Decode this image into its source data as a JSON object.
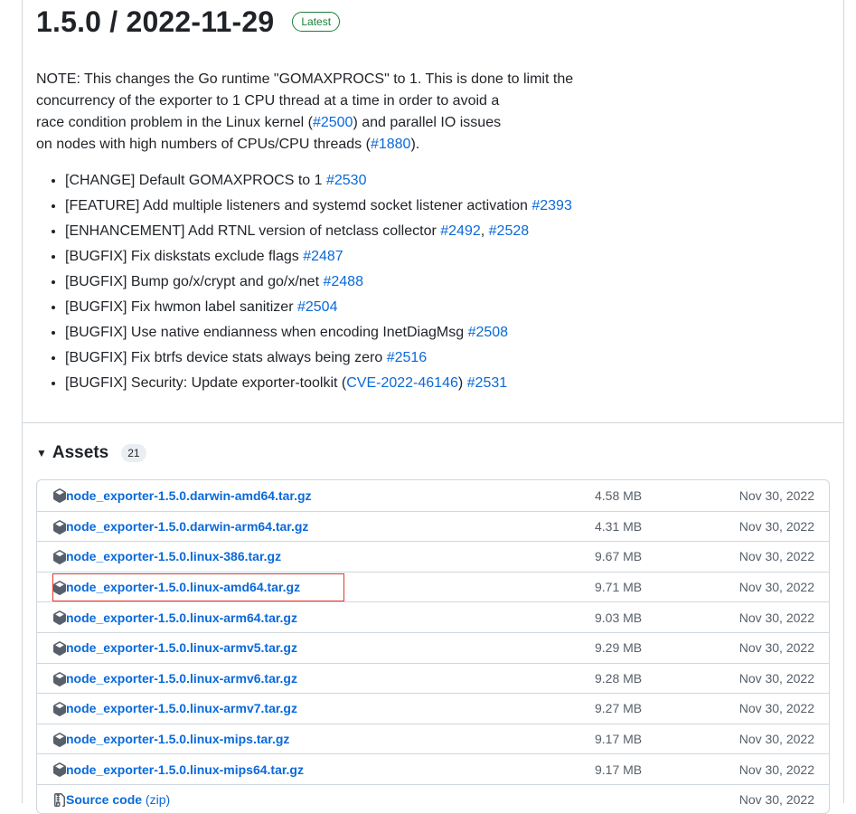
{
  "release": {
    "title": "1.5.0 / 2022-11-29",
    "badge": "Latest",
    "note_parts": [
      "NOTE: This changes the Go runtime \"GOMAXPROCS\" to 1. This is done to limit the",
      "concurrency of the exporter to 1 CPU thread at a time in order to avoid a",
      "race condition problem in the Linux kernel (",
      "#2500",
      ") and parallel IO issues",
      "on nodes with high numbers of CPUs/CPU threads (",
      "#1880",
      ")."
    ],
    "changes": [
      {
        "text": "[CHANGE] Default GOMAXPROCS to 1 ",
        "links": [
          "#2530"
        ]
      },
      {
        "text": "[FEATURE] Add multiple listeners and systemd socket listener activation ",
        "links": [
          "#2393"
        ]
      },
      {
        "text": "[ENHANCEMENT] Add RTNL version of netclass collector ",
        "links": [
          "#2492",
          "#2528"
        ]
      },
      {
        "text": "[BUGFIX] Fix diskstats exclude flags ",
        "links": [
          "#2487"
        ]
      },
      {
        "text": "[BUGFIX] Bump go/x/crypt and go/x/net ",
        "links": [
          "#2488"
        ]
      },
      {
        "text": "[BUGFIX] Fix hwmon label sanitizer ",
        "links": [
          "#2504"
        ]
      },
      {
        "text": "[BUGFIX] Use native endianness when encoding InetDiagMsg ",
        "links": [
          "#2508"
        ]
      },
      {
        "text": "[BUGFIX] Fix btrfs device stats always being zero ",
        "links": [
          "#2516"
        ]
      },
      {
        "text": "[BUGFIX] Security: Update exporter-toolkit (",
        "cve": "CVE-2022-46146",
        "after": ") ",
        "links": [
          "#2531"
        ]
      }
    ]
  },
  "assets": {
    "title": "Assets",
    "count": "21",
    "items": [
      {
        "name": "node_exporter-1.5.0.darwin-amd64.tar.gz",
        "size": "4.58 MB",
        "date": "Nov 30, 2022"
      },
      {
        "name": "node_exporter-1.5.0.darwin-arm64.tar.gz",
        "size": "4.31 MB",
        "date": "Nov 30, 2022"
      },
      {
        "name": "node_exporter-1.5.0.linux-386.tar.gz",
        "size": "9.67 MB",
        "date": "Nov 30, 2022"
      },
      {
        "name": "node_exporter-1.5.0.linux-amd64.tar.gz",
        "size": "9.71 MB",
        "date": "Nov 30, 2022"
      },
      {
        "name": "node_exporter-1.5.0.linux-arm64.tar.gz",
        "size": "9.03 MB",
        "date": "Nov 30, 2022"
      },
      {
        "name": "node_exporter-1.5.0.linux-armv5.tar.gz",
        "size": "9.29 MB",
        "date": "Nov 30, 2022"
      },
      {
        "name": "node_exporter-1.5.0.linux-armv6.tar.gz",
        "size": "9.28 MB",
        "date": "Nov 30, 2022"
      },
      {
        "name": "node_exporter-1.5.0.linux-armv7.tar.gz",
        "size": "9.27 MB",
        "date": "Nov 30, 2022"
      },
      {
        "name": "node_exporter-1.5.0.linux-mips.tar.gz",
        "size": "9.17 MB",
        "date": "Nov 30, 2022"
      },
      {
        "name": "node_exporter-1.5.0.linux-mips64.tar.gz",
        "size": "9.17 MB",
        "date": "Nov 30, 2022"
      },
      {
        "name": "Source code",
        "ext": " (zip)",
        "size": "",
        "date": "Nov 30, 2022",
        "icon": "zip-file-icon"
      }
    ]
  },
  "colors": {
    "link": "#0969da",
    "badge_green": "#1a7f37",
    "highlight_red": "#e5372b"
  }
}
